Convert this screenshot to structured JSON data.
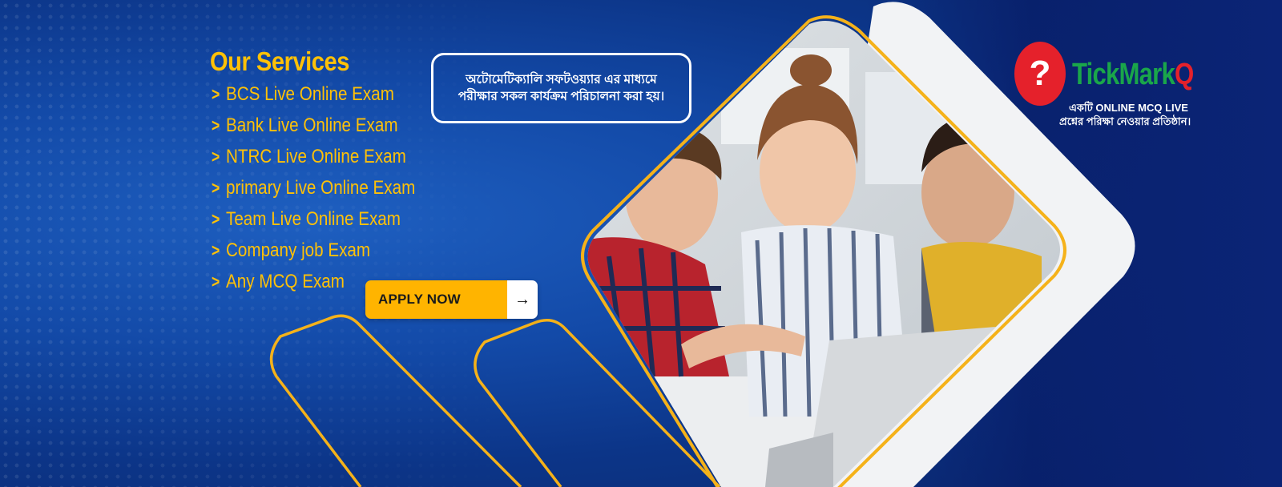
{
  "services": {
    "title": "Our Services",
    "items": [
      "BCS Live Online Exam",
      "Bank Live Online Exam",
      "NTRC Live Online Exam",
      "primary Live Online Exam",
      "Team Live Online Exam",
      "Company job Exam",
      "Any MCQ Exam"
    ]
  },
  "cta": {
    "label": "APPLY NOW"
  },
  "tagline": {
    "line1": "অটোমেটিক্যালি সফটওয়্যার এর মাধ্যমে",
    "line2": "পরীক্ষার সকল কার্যক্রম পরিচালনা করা হয়।"
  },
  "brand": {
    "name_main": "TickMark",
    "name_suffix": "Q",
    "tag_line1": "একটি ONLINE MCQ LIVE",
    "tag_line2": "প্রশ্নের পরিক্ষা নেওয়ার প্রতিষ্ঠান।"
  },
  "colors": {
    "accent": "#ffc107",
    "button": "#ffb400",
    "background": "#134aa8",
    "brand_green": "#1aa64a",
    "brand_red": "#e5212b"
  }
}
